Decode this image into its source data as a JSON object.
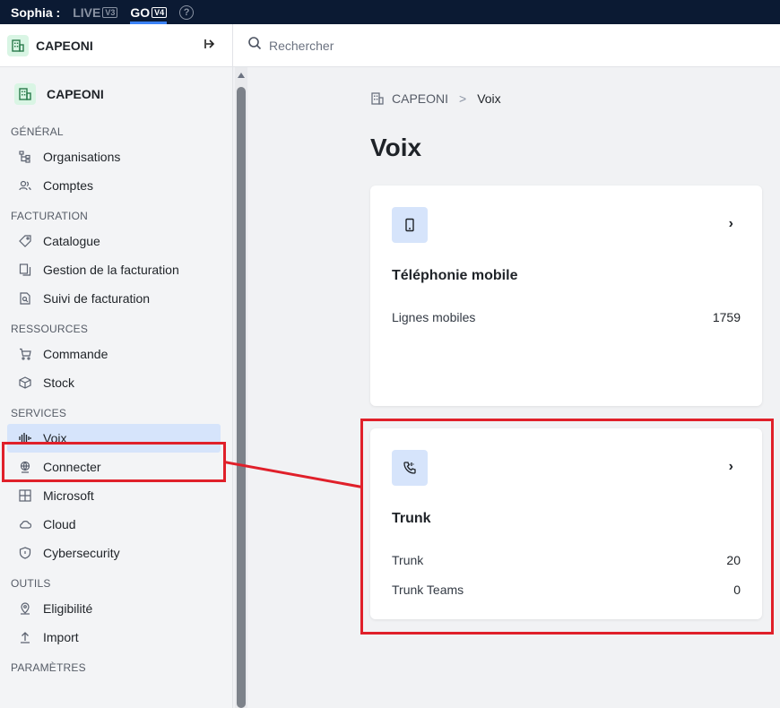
{
  "topbar": {
    "user": "Sophia :",
    "versions": [
      {
        "label": "LIVE",
        "tag": "V3"
      },
      {
        "label": "GO",
        "tag": "V4"
      }
    ],
    "help": "?"
  },
  "sidebar": {
    "org_name": "CAPEONI",
    "collapse_icon": "collapse-left-icon",
    "current_org": "CAPEONI",
    "sections": [
      {
        "title": "GÉNÉRAL",
        "items": [
          {
            "label": "Organisations",
            "icon": "org-tree-icon"
          },
          {
            "label": "Comptes",
            "icon": "users-icon"
          }
        ]
      },
      {
        "title": "FACTURATION",
        "items": [
          {
            "label": "Catalogue",
            "icon": "tag-icon"
          },
          {
            "label": "Gestion de la facturation",
            "icon": "documents-icon"
          },
          {
            "label": "Suivi de facturation",
            "icon": "document-search-icon"
          }
        ]
      },
      {
        "title": "RESSOURCES",
        "items": [
          {
            "label": "Commande",
            "icon": "cart-icon"
          },
          {
            "label": "Stock",
            "icon": "box-icon"
          }
        ]
      },
      {
        "title": "SERVICES",
        "items": [
          {
            "label": "Voix",
            "icon": "soundwave-icon",
            "active": true
          },
          {
            "label": "Connecter",
            "icon": "globe-icon"
          },
          {
            "label": "Microsoft",
            "icon": "grid-icon"
          },
          {
            "label": "Cloud",
            "icon": "cloud-icon"
          },
          {
            "label": "Cybersecurity",
            "icon": "shield-icon"
          }
        ]
      },
      {
        "title": "OUTILS",
        "items": [
          {
            "label": "Eligibilité",
            "icon": "location-icon"
          },
          {
            "label": "Import",
            "icon": "upload-icon"
          }
        ]
      },
      {
        "title": "PARAMÈTRES",
        "items": []
      }
    ]
  },
  "search": {
    "placeholder": "Rechercher",
    "icon": "search-icon"
  },
  "breadcrumb": {
    "org": "CAPEONI",
    "separator": ">",
    "current": "Voix"
  },
  "page_title": "Voix",
  "cards": [
    {
      "title": "Téléphonie mobile",
      "icon": "mobile-phone-icon",
      "rows": [
        {
          "label": "Lignes mobiles",
          "value": "1759"
        }
      ]
    },
    {
      "title": "Trunk",
      "icon": "phone-wave-icon",
      "rows": [
        {
          "label": "Trunk",
          "value": "20"
        },
        {
          "label": "Trunk Teams",
          "value": "0"
        }
      ]
    }
  ],
  "colors": {
    "topbar": "#0b1a33",
    "active_item": "#d6e4fb",
    "accent": "#3b82f6",
    "highlight": "#e0202a",
    "logo_bg": "#d9f5e4"
  }
}
